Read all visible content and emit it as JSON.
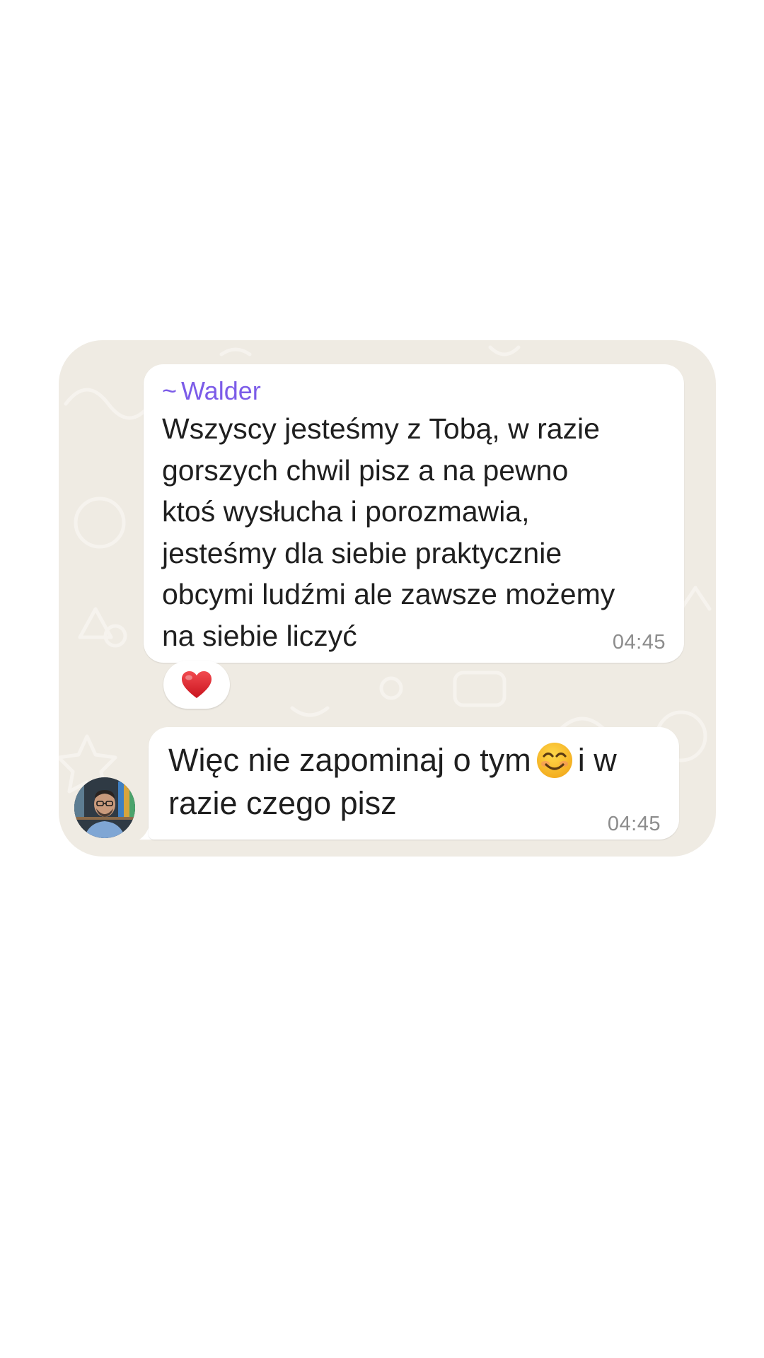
{
  "theme": {
    "card_background": "#efebe3",
    "bubble_background": "#ffffff",
    "sender_color": "#7c5ce8",
    "timestamp_color": "#8c8c8c",
    "text_color": "#1f1f1f",
    "reaction_heart_color": "#e0242f"
  },
  "messages": [
    {
      "sender_prefix": "~",
      "sender": "Walder",
      "text": "Wszyscy jesteśmy z Tobą, w razie\ngorszych chwil pisz a na pewno\nktoś wysłucha i porozmawia,\njesteśmy dla siebie praktycznie\nobcymi ludźmi ale zawsze możemy\nna siebie liczyć",
      "time": "04:45",
      "reaction_icon": "red-heart-icon"
    },
    {
      "text_before_emoji": "Więc nie zapominaj o tym",
      "inline_emoji": "smiling-face-icon",
      "text_after_emoji": "i w\nrazie czego pisz",
      "time": "04:45",
      "avatar_icon": "user-avatar"
    }
  ]
}
